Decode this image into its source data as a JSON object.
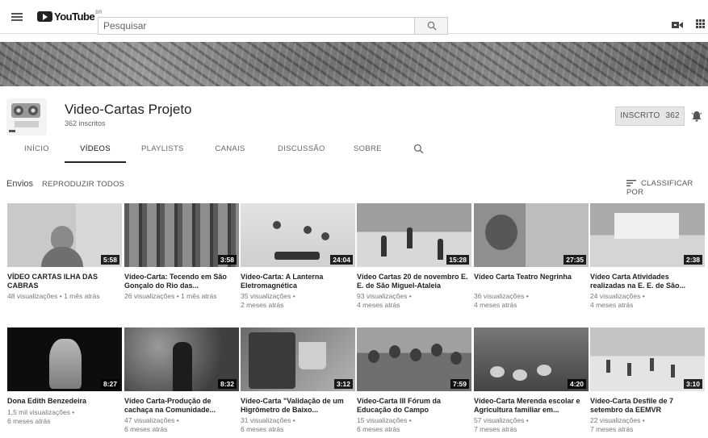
{
  "header": {
    "logo_text": "YouTube",
    "logo_region": "BR",
    "search_placeholder": "Pesquisar"
  },
  "channel": {
    "name": "Video-Cartas Projeto",
    "subscribers": "362 inscritos",
    "subscribed_label": "INSCRITO",
    "subscribed_count": "362"
  },
  "tabs": [
    {
      "label": "INÍCIO"
    },
    {
      "label": "VÍDEOS"
    },
    {
      "label": "PLAYLISTS"
    },
    {
      "label": "CANAIS"
    },
    {
      "label": "DISCUSSÃO"
    },
    {
      "label": "SOBRE"
    }
  ],
  "section": {
    "title": "Envios",
    "play_all": "REPRODUZIR TODOS",
    "sort": "CLASSIFICAR POR"
  },
  "videos": [
    {
      "title": "VÍDEO CARTAS ILHA DAS CABRAS",
      "duration": "5:58",
      "meta1": "48 visualizações • 1 mês atrás",
      "meta2": ""
    },
    {
      "title": "Vídeo-Carta: Tecendo em São Gonçalo do Rio das...",
      "duration": "3:58",
      "meta1": "26 visualizações • 1 mês atrás",
      "meta2": ""
    },
    {
      "title": "Vídeo-Carta: A Lanterna Eletromagnética",
      "duration": "24:04",
      "meta1": "35 visualizações •",
      "meta2": "2 meses atrás"
    },
    {
      "title": "Vídeo Cartas 20 de novembro E. E. de São Miguel-Ataleia",
      "duration": "15:28",
      "meta1": "93 visualizações •",
      "meta2": "4 meses atrás"
    },
    {
      "title": "Vídeo Carta Teatro Negrinha",
      "duration": "27:35",
      "meta1": "36 visualizações •",
      "meta2": "4 meses atrás"
    },
    {
      "title": "Vídeo Carta Atividades realizadas na E. E. de São...",
      "duration": "2:38",
      "meta1": "24 visualizações •",
      "meta2": "4 meses atrás"
    },
    {
      "title": "Dona Edith Benzedeira",
      "duration": "8:27",
      "meta1": "1,5 mil visualizações •",
      "meta2": "6 meses atrás"
    },
    {
      "title": "Vídeo Carta-Produção de cachaça na Comunidade...",
      "duration": "8:32",
      "meta1": "47 visualizações •",
      "meta2": "6 meses atrás"
    },
    {
      "title": "Vídeo-Carta \"Validação de um Higrômetro de Baixo...",
      "duration": "3:12",
      "meta1": "31 visualizações •",
      "meta2": "6 meses atrás"
    },
    {
      "title": "Vídeo-Carta III Fórum da Educação do Campo",
      "duration": "7:59",
      "meta1": "15 visualizações •",
      "meta2": "6 meses atrás"
    },
    {
      "title": "Vídeo-Carta Merenda escolar e Agricultura familiar em...",
      "duration": "4:20",
      "meta1": "57 visualizações •",
      "meta2": "7 meses atrás"
    },
    {
      "title": "Vídeo-Carta Desfile de 7 setembro da EEMVR",
      "duration": "3:10",
      "meta1": "22 visualizações •",
      "meta2": "7 meses atrás"
    }
  ]
}
